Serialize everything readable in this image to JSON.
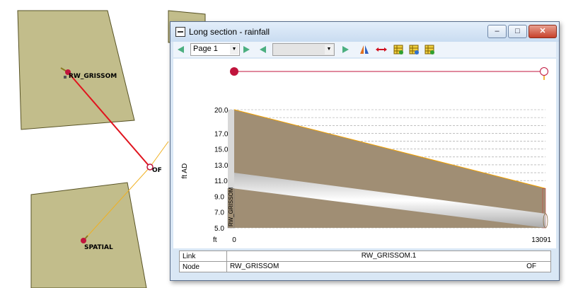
{
  "map": {
    "nodes": {
      "rw_grissom": "RW_GRISSOM",
      "spatial": "SPATIAL",
      "outfall": "OF"
    },
    "colors": {
      "subcatchment_fill": "#c2bd8b",
      "subcatchment_border": "#575224",
      "selected_link": "#e0141e",
      "link": "#f0b020",
      "node": "#c0143c"
    }
  },
  "window": {
    "title": "Long section - rainfall",
    "buttons": {
      "minimize": "–",
      "maximize": "□",
      "close": "✕"
    }
  },
  "toolbar": {
    "page_select": "Page 1",
    "second_select": "",
    "icons": [
      "prev-page-icon",
      "next-page-icon",
      "prev-icon",
      "next-icon",
      "flip-icon",
      "link-range-icon",
      "grid-icon-1",
      "grid-icon-2",
      "grid-icon-3"
    ]
  },
  "chart_data": {
    "type": "area",
    "ylabel": "ft AD",
    "xlabel": "ft",
    "ylim": [
      5.0,
      20.0
    ],
    "y_ticks": [
      "20.0",
      "17.0",
      "15.0",
      "13.0",
      "11.0",
      "9.0",
      "7.0",
      "5.0"
    ],
    "y_tick_values": [
      20.0,
      17.0,
      15.0,
      13.0,
      11.0,
      9.0,
      7.0,
      5.0
    ],
    "x_ticks": [
      "0",
      "13091"
    ],
    "x_tick_values": [
      0,
      13091
    ],
    "node_label": "RW_GRISSOM",
    "ground_level": {
      "x": [
        0,
        13091
      ],
      "y": [
        20.0,
        10.0
      ]
    },
    "pipe_top": {
      "x": [
        0,
        13091
      ],
      "y": [
        12.0,
        6.8
      ]
    },
    "pipe_invert": {
      "x": [
        0,
        13091
      ],
      "y": [
        10.0,
        5.0
      ]
    },
    "colors": {
      "ground": "#a08e74",
      "pipe": "#e8e8e8",
      "ground_line": "#f0a000",
      "selection": "#c0143c"
    }
  },
  "table": {
    "rows": [
      {
        "label": "Link",
        "start": "",
        "middle": "RW_GRISSOM.1",
        "end": ""
      },
      {
        "label": "Node",
        "start": "RW_GRISSOM",
        "middle": "",
        "end": "OF"
      }
    ]
  }
}
